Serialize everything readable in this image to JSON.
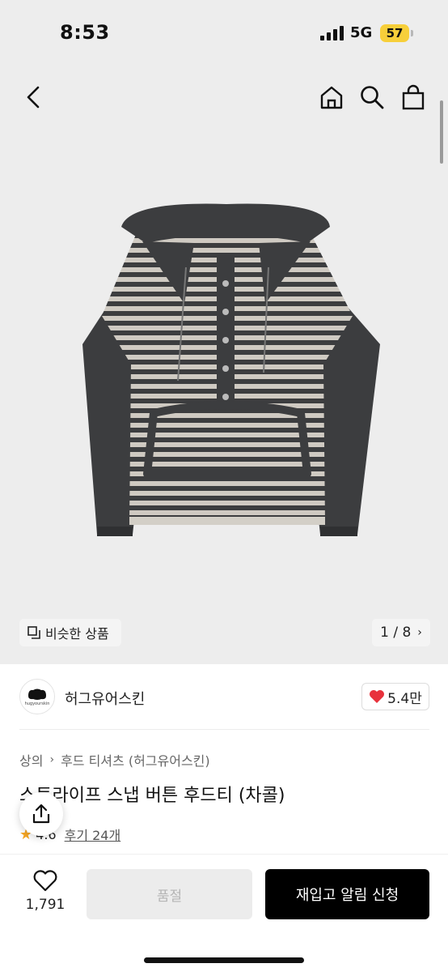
{
  "status_bar": {
    "time": "8:53",
    "network": "5G",
    "battery": "57"
  },
  "gallery": {
    "similar_label": "비슷한 상품",
    "counter": "1 / 8"
  },
  "store": {
    "name": "허그유어스킨",
    "logo_text": "hugyourskin",
    "likes": "5.4만"
  },
  "breadcrumb": {
    "category": "상의",
    "subcategory": "후드 티셔츠 (허그유어스킨)"
  },
  "product": {
    "title": "스트라이프 스냅 버튼 후드티 (차콜)",
    "rating": "4.6",
    "reviews": "후기 24개"
  },
  "bottom_bar": {
    "wish_count": "1,791",
    "soldout_label": "품절",
    "restock_label": "재입고 알림 신청"
  },
  "colors": {
    "accent": "#000000",
    "heart": "#e8323c",
    "star": "#f5a623",
    "battery": "#f7cf3a",
    "garment_dark": "#3c3d3f",
    "garment_stripe_light": "#cfcac2"
  }
}
